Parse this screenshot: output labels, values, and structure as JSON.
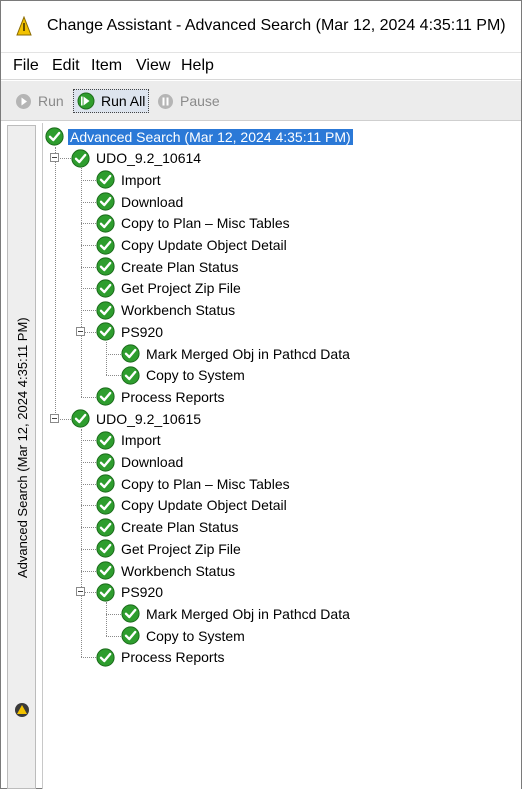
{
  "window": {
    "title": "Change Assistant - Advanced Search (Mar 12, 2024 4:35:11 PM)"
  },
  "menu": [
    "File",
    "Edit",
    "Item",
    "View",
    "Help"
  ],
  "toolbar": {
    "run": "Run",
    "run_all": "Run All",
    "pause": "Pause"
  },
  "side_tab": {
    "label": "Advanced Search (Mar 12, 2024 4:35:11 PM)"
  },
  "tree": {
    "root": "Advanced Search (Mar 12, 2024 4:35:11 PM)",
    "groups": [
      {
        "name": "UDO_9.2_10614",
        "steps": [
          "Import",
          "Download",
          "Copy to Plan – Misc Tables",
          "Copy Update Object Detail",
          "Create Plan Status",
          "Get Project Zip File",
          "Workbench Status"
        ],
        "sub_group": {
          "name": "PS920",
          "steps": [
            "Mark Merged Obj in Pathcd Data",
            "Copy to System"
          ]
        },
        "final_step": "Process Reports"
      },
      {
        "name": "UDO_9.2_10615",
        "steps": [
          "Import",
          "Download",
          "Copy to Plan – Misc Tables",
          "Copy Update Object Detail",
          "Create Plan Status",
          "Get Project Zip File",
          "Workbench Status"
        ],
        "sub_group": {
          "name": "PS920",
          "steps": [
            "Mark Merged Obj in Pathcd Data",
            "Copy to System"
          ]
        },
        "final_step": "Process Reports"
      }
    ]
  },
  "colors": {
    "selection": "#2b79d7",
    "check_green": "#2e9d2e",
    "toolbar_bg": "#ececec"
  }
}
